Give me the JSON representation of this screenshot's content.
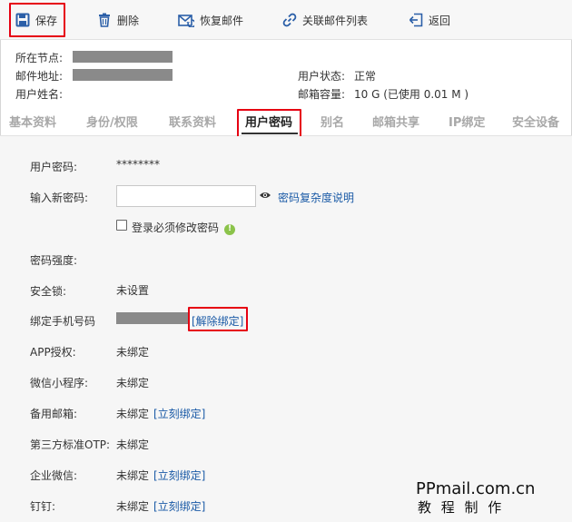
{
  "toolbar": {
    "save_label": "保存",
    "delete_label": "删除",
    "restore_label": "恢复邮件",
    "linked_list_label": "关联邮件列表",
    "back_label": "返回"
  },
  "info": {
    "node_label": "所在节点:",
    "email_label": "邮件地址:",
    "username_label": "用户姓名:",
    "status_label": "用户状态:",
    "status_value": "正常",
    "capacity_label": "邮箱容量:",
    "capacity_value": "10 G (已使用 0.01 M )"
  },
  "tabs": [
    {
      "label": "基本资料"
    },
    {
      "label": "身份/权限"
    },
    {
      "label": "联系资料"
    },
    {
      "label": "用户密码"
    },
    {
      "label": "别名"
    },
    {
      "label": "邮箱共享"
    },
    {
      "label": "IP绑定"
    },
    {
      "label": "安全设备"
    }
  ],
  "password": {
    "current_label": "用户密码:",
    "current_value": "********",
    "new_label": "输入新密码:",
    "new_value": "",
    "complexity_link": "密码复杂度说明",
    "force_change_label": "登录必须修改密码",
    "strength_label": "密码强度:",
    "lock_label": "安全锁:",
    "lock_value": "未设置",
    "phone_label": "绑定手机号码",
    "unbind_link": "[解除绑定]",
    "app_label": "APP授权:",
    "app_value": "未绑定",
    "miniprogram_label": "微信小程序:",
    "miniprogram_value": "未绑定",
    "backup_label": "备用邮箱:",
    "backup_value": "未绑定",
    "backup_link": "[立刻绑定]",
    "otp_label": "第三方标准OTP:",
    "otp_value": "未绑定",
    "wecom_label": "企业微信:",
    "wecom_value": "未绑定",
    "wecom_link": "[立刻绑定]",
    "dingtalk_label": "钉钉:",
    "dingtalk_value": "未绑定",
    "dingtalk_link": "[立刻绑定]"
  },
  "watermark": {
    "line1": "PPmail.com.cn",
    "line2": "教 程 制 作"
  },
  "colors": {
    "highlight": "#e60012",
    "link": "#1a5aa6",
    "icon": "#2b5fa8"
  }
}
